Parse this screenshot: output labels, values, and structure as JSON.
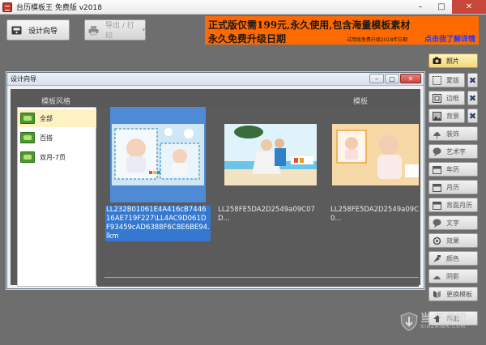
{
  "window": {
    "title": "台历模板王 免费版 v2018",
    "minimize": "–",
    "maximize": "□",
    "close": "✕"
  },
  "toolbar": {
    "design_wizard": "设计向导",
    "export_print": "导出 / 打印"
  },
  "banner": {
    "line1": "正式版仅需199元,永久使用,包含海量模板素材",
    "line2": "永久免费升级日期",
    "note": "试用版免费升级2018年日期",
    "link": "点击我了解详情"
  },
  "dialog": {
    "title": "设计向导",
    "min": "–",
    "max": "□",
    "close": "✕",
    "style_header": "模板风格",
    "template_header": "模板",
    "styles": [
      {
        "label": "全部"
      },
      {
        "label": "百搭"
      },
      {
        "label": "双月-7页"
      }
    ],
    "templates": [
      {
        "label": "LL232B01061E4A416cB744616AE719F227\\LL4AC9D061DF93459cAD6388F6C8E6BE94.lkm"
      },
      {
        "label": "LL258FE5DA2D2549a09C07D..."
      },
      {
        "label": "LL258FE5DA2D2549a09C0..."
      }
    ]
  },
  "right_panel": {
    "items": [
      {
        "label": "照片",
        "icon": "camera-icon"
      },
      {
        "label": "蒙版",
        "icon": "mask-icon"
      },
      {
        "label": "边框",
        "icon": "frame-icon"
      },
      {
        "label": "背景",
        "icon": "background-icon"
      },
      {
        "label": "装饰",
        "icon": "decor-icon"
      },
      {
        "label": "艺术字",
        "icon": "art-text-icon"
      },
      {
        "label": "年历",
        "icon": "year-calendar-icon"
      },
      {
        "label": "月历",
        "icon": "month-calendar-icon"
      },
      {
        "label": "背面月历",
        "icon": "back-calendar-icon"
      },
      {
        "label": "文字",
        "icon": "text-icon"
      },
      {
        "label": "效果",
        "icon": "effect-icon"
      },
      {
        "label": "颜色",
        "icon": "color-icon"
      },
      {
        "label": "阴影",
        "icon": "shadow-icon"
      },
      {
        "label": "更换模板",
        "icon": "template-icon"
      },
      {
        "label": "帮助",
        "icon": "help-icon"
      }
    ],
    "delete_glyph": "✖"
  },
  "watermark": {
    "text": "当 下载吧",
    "sub": "XIAZAIBA.COM"
  }
}
